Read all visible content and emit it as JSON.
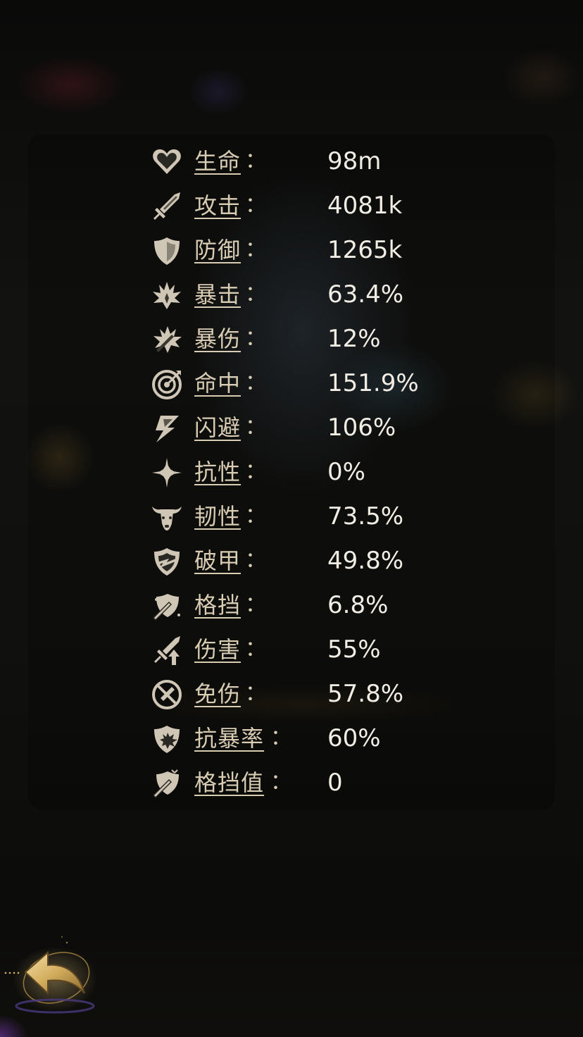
{
  "stats": [
    {
      "icon": "heart-icon",
      "label": "生命",
      "value": "98m"
    },
    {
      "icon": "sword-icon",
      "label": "攻击",
      "value": "4081k"
    },
    {
      "icon": "shield-icon",
      "label": "防御",
      "value": "1265k"
    },
    {
      "icon": "crit-burst-icon",
      "label": "暴击",
      "value": "63.4%"
    },
    {
      "icon": "crit-damage-icon",
      "label": "暴伤",
      "value": "12%"
    },
    {
      "icon": "target-icon",
      "label": "命中",
      "value": "151.9%"
    },
    {
      "icon": "dodge-lightning-icon",
      "label": "闪避",
      "value": "106%"
    },
    {
      "icon": "star-burst-icon",
      "label": "抗性",
      "value": "0%"
    },
    {
      "icon": "bull-head-icon",
      "label": "韧性",
      "value": "73.5%"
    },
    {
      "icon": "armor-break-icon",
      "label": "破甲",
      "value": "49.8%"
    },
    {
      "icon": "block-icon",
      "label": "格挡",
      "value": "6.8%"
    },
    {
      "icon": "damage-up-icon",
      "label": "伤害",
      "value": "55%"
    },
    {
      "icon": "damage-reduction-icon",
      "label": "免伤",
      "value": "57.8%"
    },
    {
      "icon": "anti-crit-shield-icon",
      "label": "抗暴率",
      "value": "60%"
    },
    {
      "icon": "block-value-icon",
      "label": "格挡值",
      "value": "0"
    }
  ],
  "colon": "：",
  "back_button": {
    "icon": "back-arrow-icon"
  },
  "colors": {
    "label": "#d8ccb3",
    "value": "#f1ede4",
    "icon": "#cfc6b6",
    "gold": "#d6b56a"
  }
}
